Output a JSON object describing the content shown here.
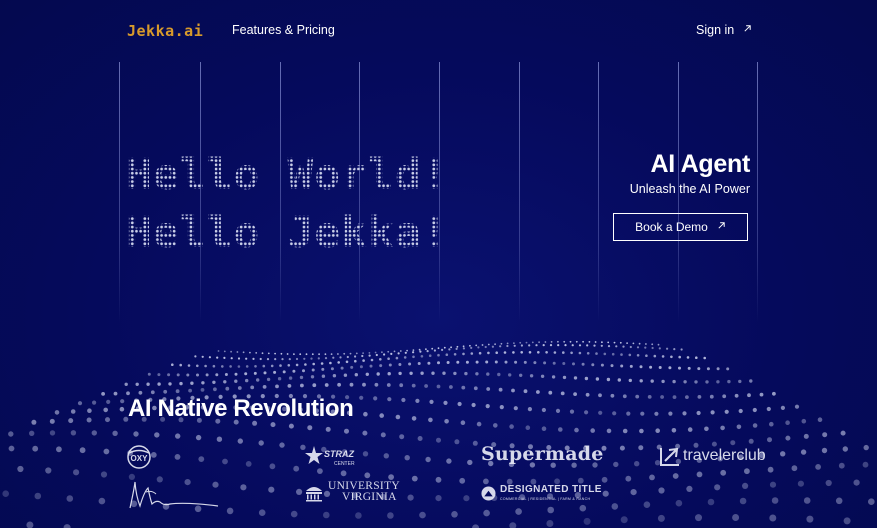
{
  "nav": {
    "logo": "Jekka.ai",
    "features_link": "Features & Pricing",
    "sign_in": "Sign in",
    "sign_in_icon": "arrow-up-right-icon"
  },
  "hero": {
    "line1": "Hello World!",
    "line2": "Hello Jekka!",
    "title": "AI Agent",
    "subtitle": "Unleash the AI Power",
    "demo_button": "Book a Demo",
    "demo_icon": "arrow-up-right-icon"
  },
  "revolution": {
    "title": "AI Native Revolution",
    "logos": {
      "oxy": "OXY",
      "straz": "STRAZ",
      "straz_sub": "CENTER",
      "supermade": "Supermade",
      "traveler": "travelerclub",
      "uva_line1": "UNIVERSITY",
      "uva_line2": "VIRGINIA",
      "designated": "DESIGNATED TITLE",
      "designated_sub": "COMMERCIAL | RESIDENTIAL | FARM & RANCH"
    }
  },
  "colors": {
    "background": "#050a5c",
    "logo_accent": "#d79a2b",
    "text": "#ffffff"
  }
}
